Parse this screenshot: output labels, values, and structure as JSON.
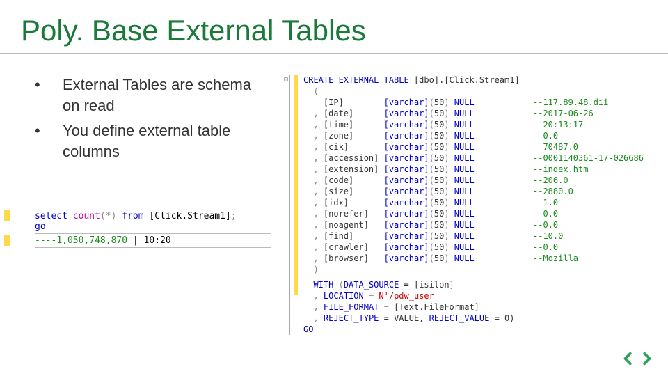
{
  "title": "Poly. Base External Tables",
  "bullets": [
    "External Tables are schema on read",
    "You define external table columns"
  ],
  "query": {
    "select_kw": "select",
    "count_fn": "count",
    "star": "(*)",
    "from_kw": "from",
    "target": "[Click.Stream1]",
    "semicolon": ";",
    "go": "go",
    "result_prefix": "----",
    "result_count": "1,050,748,870",
    "result_sep": " | ",
    "result_time": "10:20"
  },
  "create_stmt": {
    "create_kw": "CREATE EXTERNAL TABLE",
    "table_name": "[dbo].[Click.Stream1]",
    "open": "(",
    "close": ")",
    "with_kw": "WITH",
    "with_open": "(",
    "data_source_kw": "DATA_SOURCE",
    "data_source_eq": " = [isilon]",
    "location_kw": "LOCATION",
    "location_eq": " = ",
    "location_val_prefix": "N'",
    "location_val": "/pdw_user",
    "file_format_kw": "FILE_FORMAT",
    "file_format_eq": " = [Text.FileFormat]",
    "reject_type_kw": "REJECT_TYPE",
    "reject_type_val": " = VALUE,",
    "reject_value_kw": "REJECT_VALUE",
    "reject_value_val": " = 0)",
    "go": "GO"
  },
  "columns": [
    {
      "name": "IP",
      "type": "[varchar](50)",
      "null": "NULL",
      "comment": "--117.89.48.dii"
    },
    {
      "name": "date",
      "type": "[varchar](50)",
      "null": "NULL",
      "comment": "--2017-06-26"
    },
    {
      "name": "time",
      "type": "[varchar](50)",
      "null": "NULL",
      "comment": "--20:13:17"
    },
    {
      "name": "zone",
      "type": "[varchar](50)",
      "null": "NULL",
      "comment": "--0.0"
    },
    {
      "name": "cik",
      "type": "[varchar](50)",
      "null": "NULL",
      "comment": "  70487.0"
    },
    {
      "name": "accession",
      "type": "[varchar](50)",
      "null": "NULL",
      "comment": "--0001140361-17-026686"
    },
    {
      "name": "extension",
      "type": "[varchar](50)",
      "null": "NULL",
      "comment": "--index.htm"
    },
    {
      "name": "code",
      "type": "[varchar](50)",
      "null": "NULL",
      "comment": "--206.0"
    },
    {
      "name": "size",
      "type": "[varchar](50)",
      "null": "NULL",
      "comment": "--2880.0"
    },
    {
      "name": "idx",
      "type": "[varchar](50)",
      "null": "NULL",
      "comment": "--1.0"
    },
    {
      "name": "norefer",
      "type": "[varchar](50)",
      "null": "NULL",
      "comment": "--0.0"
    },
    {
      "name": "noagent",
      "type": "[varchar](50)",
      "null": "NULL",
      "comment": "--0.0"
    },
    {
      "name": "find",
      "type": "[varchar](50)",
      "null": "NULL",
      "comment": "--10.0"
    },
    {
      "name": "crawler",
      "type": "[varchar](50)",
      "null": "NULL",
      "comment": "--0.0"
    },
    {
      "name": "browser",
      "type": "[varchar](50)",
      "null": "NULL",
      "comment": "--Mozilla"
    }
  ]
}
